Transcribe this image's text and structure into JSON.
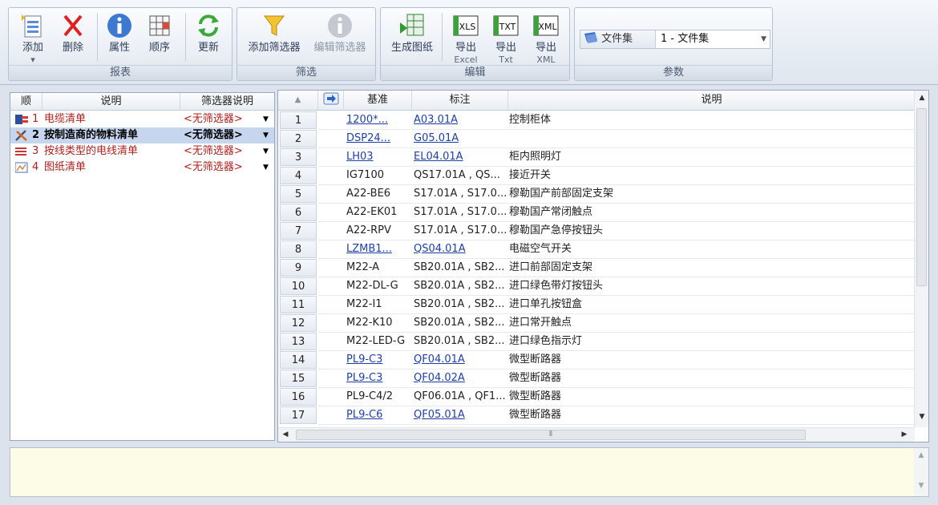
{
  "ribbon": {
    "groups": {
      "report": {
        "title": "报表",
        "add": "添加",
        "delete": "删除",
        "properties": "属性",
        "order": "顺序",
        "update": "更新"
      },
      "filter": {
        "title": "筛选",
        "add_filter": "添加筛选器",
        "edit_filter": "编辑筛选器"
      },
      "edit": {
        "title": "编辑",
        "generate": "生成图纸",
        "export_excel": "导出",
        "export_excel_sub": "Excel",
        "export_txt": "导出",
        "export_txt_sub": "Txt",
        "export_xml": "导出",
        "export_xml_sub": "XML",
        "xls_badge": "XLS",
        "txt_badge": "TXT",
        "xml_badge": "XML"
      },
      "params": {
        "title": "参数",
        "label": "文件集",
        "value": "1 - 文件集"
      }
    }
  },
  "left": {
    "headers": {
      "order": "顺",
      "desc": "说明",
      "filter": "筛选器说明"
    },
    "rows": [
      {
        "num": "1",
        "label": "电缆清单",
        "filter": "<无筛选器>",
        "icon": "cable-list-icon",
        "selected": false
      },
      {
        "num": "2",
        "label": "按制造商的物料清单",
        "filter": "<无筛选器>",
        "icon": "bom-tools-icon",
        "selected": true
      },
      {
        "num": "3",
        "label": "按线类型的电线清单",
        "filter": "<无筛选器>",
        "icon": "wire-list-icon",
        "selected": false
      },
      {
        "num": "4",
        "label": "图纸清单",
        "filter": "<无筛选器>",
        "icon": "drawing-list-icon",
        "selected": false
      }
    ]
  },
  "grid": {
    "headers": {
      "base": "基准",
      "tag": "标注",
      "desc": "说明"
    },
    "rows": [
      {
        "n": "1",
        "base": "1200*...",
        "tag": "A03.01A",
        "desc": "控制柜体",
        "link": true
      },
      {
        "n": "2",
        "base": "DSP24...",
        "tag": "G05.01A",
        "desc": "",
        "link": true
      },
      {
        "n": "3",
        "base": "LH03",
        "tag": "EL04.01A",
        "desc": "柜内照明灯",
        "link": true
      },
      {
        "n": "4",
        "base": "IG7100",
        "tag": "QS17.01A , QS...",
        "desc": "接近开关",
        "link": false
      },
      {
        "n": "5",
        "base": "A22-BE6",
        "tag": "S17.01A , S17.0...",
        "desc": "穆勒国产前部固定支架",
        "link": false
      },
      {
        "n": "6",
        "base": "A22-EK01",
        "tag": "S17.01A , S17.0...",
        "desc": "穆勒国产常闭触点",
        "link": false
      },
      {
        "n": "7",
        "base": "A22-RPV",
        "tag": "S17.01A , S17.0...",
        "desc": "穆勒国产急停按钮头",
        "link": false
      },
      {
        "n": "8",
        "base": "LZMB1...",
        "tag": "QS04.01A",
        "desc": "电磁空气开关",
        "link": true
      },
      {
        "n": "9",
        "base": "M22-A",
        "tag": "SB20.01A , SB2...",
        "desc": "进口前部固定支架",
        "link": false
      },
      {
        "n": "10",
        "base": "M22-DL-G",
        "tag": "SB20.01A , SB2...",
        "desc": "进口绿色带灯按钮头",
        "link": false
      },
      {
        "n": "11",
        "base": "M22-I1",
        "tag": "SB20.01A , SB2...",
        "desc": "进口单孔按钮盒",
        "link": false
      },
      {
        "n": "12",
        "base": "M22-K10",
        "tag": "SB20.01A , SB2...",
        "desc": "进口常开触点",
        "link": false
      },
      {
        "n": "13",
        "base": "M22-LED-G",
        "tag": "SB20.01A , SB2...",
        "desc": "进口绿色指示灯",
        "link": false
      },
      {
        "n": "14",
        "base": "PL9-C3",
        "tag": "QF04.01A",
        "desc": "微型断路器",
        "link": true
      },
      {
        "n": "15",
        "base": "PL9-C3",
        "tag": "QF04.02A",
        "desc": "微型断路器",
        "link": true
      },
      {
        "n": "16",
        "base": "PL9-C4/2",
        "tag": "QF06.01A , QF1...",
        "desc": "微型断路器",
        "link": false
      },
      {
        "n": "17",
        "base": "PL9-C6",
        "tag": "QF05.01A",
        "desc": "微型断路器",
        "link": true
      }
    ]
  },
  "colors": {
    "accent": "#1f3fa8",
    "row_label_red": "#b0201c",
    "selected_row": "#c6d6ef",
    "description_bg": "#fdfce6"
  }
}
